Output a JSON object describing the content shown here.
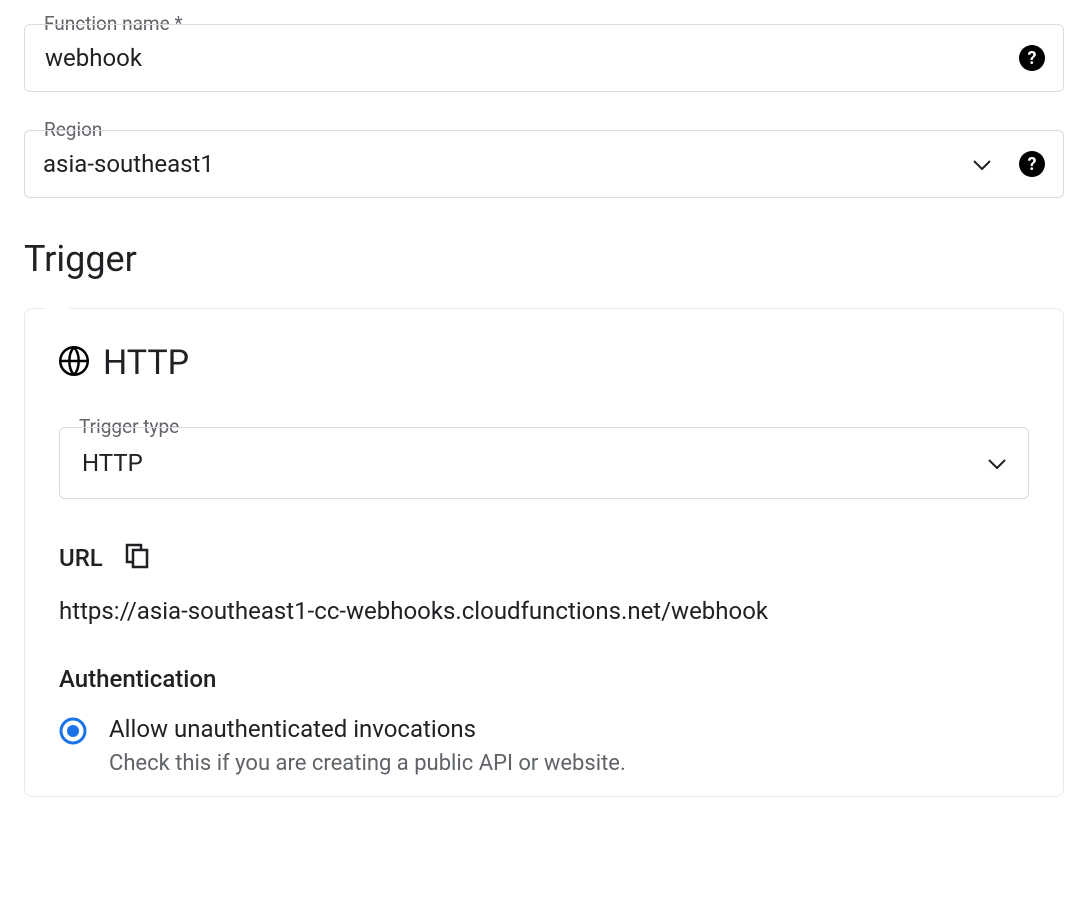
{
  "functionName": {
    "label": "Function name *",
    "value": "webhook"
  },
  "region": {
    "label": "Region",
    "value": "asia-southeast1"
  },
  "triggerSection": {
    "title": "Trigger",
    "header": "HTTP",
    "typeField": {
      "label": "Trigger type",
      "value": "HTTP"
    },
    "url": {
      "label": "URL",
      "value": "https://asia-southeast1-cc-webhooks.cloudfunctions.net/webhook"
    },
    "auth": {
      "title": "Authentication",
      "option1": {
        "label": "Allow unauthenticated invocations",
        "sub": "Check this if you are creating a public API or website."
      }
    }
  }
}
